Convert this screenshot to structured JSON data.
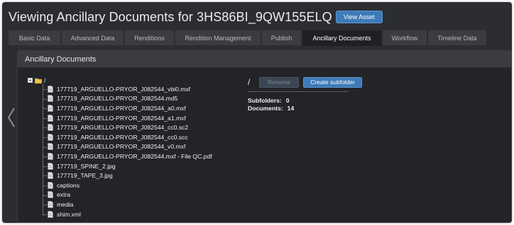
{
  "header": {
    "title": "Viewing Ancillary Documents for 3HS86BI_9QW155ELQ",
    "view_asset_label": "View Asset"
  },
  "tabs": [
    {
      "label": "Basic Data",
      "active": false
    },
    {
      "label": "Advanced Data",
      "active": false
    },
    {
      "label": "Renditions",
      "active": false
    },
    {
      "label": "Rendition Management",
      "active": false
    },
    {
      "label": "Publish",
      "active": false
    },
    {
      "label": "Ancillary Documents",
      "active": true
    },
    {
      "label": "Workflow",
      "active": false
    },
    {
      "label": "Timeline Data",
      "active": false
    }
  ],
  "panel": {
    "title": "Ancillary Documents"
  },
  "tree": {
    "root_label": "/",
    "items": [
      {
        "label": "177719_ARGUELLO-PRYOR_J082544_vbi0.mxf"
      },
      {
        "label": "177719_ARGUELLO-PRYOR_J082544.md5"
      },
      {
        "label": "177719_ARGUELLO-PRYOR_J082544_a0.mxf"
      },
      {
        "label": "177719_ARGUELLO-PRYOR_J082544_a1.mxf"
      },
      {
        "label": "177719_ARGUELLO-PRYOR_J082544_cc0.sc2"
      },
      {
        "label": "177719_ARGUELLO-PRYOR_J082544_cc0.scc"
      },
      {
        "label": "177719_ARGUELLO-PRYOR_J082544_v0.mxf"
      },
      {
        "label": "177719_ARGUELLO-PRYOR_J082544.mxf - File QC.pdf"
      },
      {
        "label": "177719_SPINE_2.jpg"
      },
      {
        "label": "177719_TAPE_3.jpg"
      },
      {
        "label": "captions"
      },
      {
        "label": "extra"
      },
      {
        "label": "media"
      },
      {
        "label": "shim.xml"
      }
    ]
  },
  "details": {
    "path": "/",
    "rename_label": "Rename",
    "create_subfolder_label": "Create subfolder",
    "subfolders_label": "Subfolders:",
    "subfolders_value": "0",
    "documents_label": "Documents:",
    "documents_value": "14"
  },
  "colors": {
    "background": "#2b2d30",
    "accent": "#3d7ab8",
    "active_tab": "#1f2023"
  }
}
